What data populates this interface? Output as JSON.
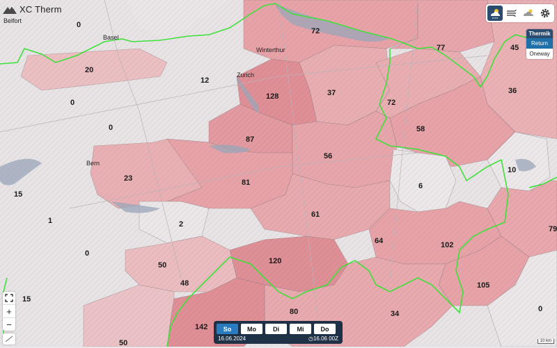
{
  "app": {
    "title": "XC Therm"
  },
  "top_buttons": [
    {
      "icon": "thermal-cloud-icon",
      "active": true
    },
    {
      "icon": "wind-icon",
      "active": false
    },
    {
      "icon": "cloud-icon",
      "active": false
    },
    {
      "icon": "gear-icon",
      "active": false
    }
  ],
  "thermik_panel": {
    "header": "Thermik",
    "options": [
      "Return",
      "Oneway"
    ],
    "selected": "Return"
  },
  "zoom": {
    "in": "+",
    "out": "−"
  },
  "days": {
    "items": [
      "So",
      "Mo",
      "Di",
      "Mi",
      "Do"
    ],
    "active": "So",
    "date": "16.06.2024",
    "time": "16.06 00Z"
  },
  "scale_label": "10 km",
  "region_values": [
    "0",
    "72",
    "77",
    "45",
    "20",
    "12",
    "36",
    "0",
    "128",
    "37",
    "72",
    "0",
    "58",
    "87",
    "15",
    "23",
    "56",
    "10",
    "81",
    "6",
    "1",
    "2",
    "61",
    "79",
    "0",
    "64",
    "102",
    "120",
    "50",
    "48",
    "105",
    "15",
    "0",
    "80",
    "34",
    "142",
    "50"
  ],
  "city_labels": [
    "Belfort",
    "Basel",
    "Winterthur",
    "Zurich",
    "Bern"
  ]
}
